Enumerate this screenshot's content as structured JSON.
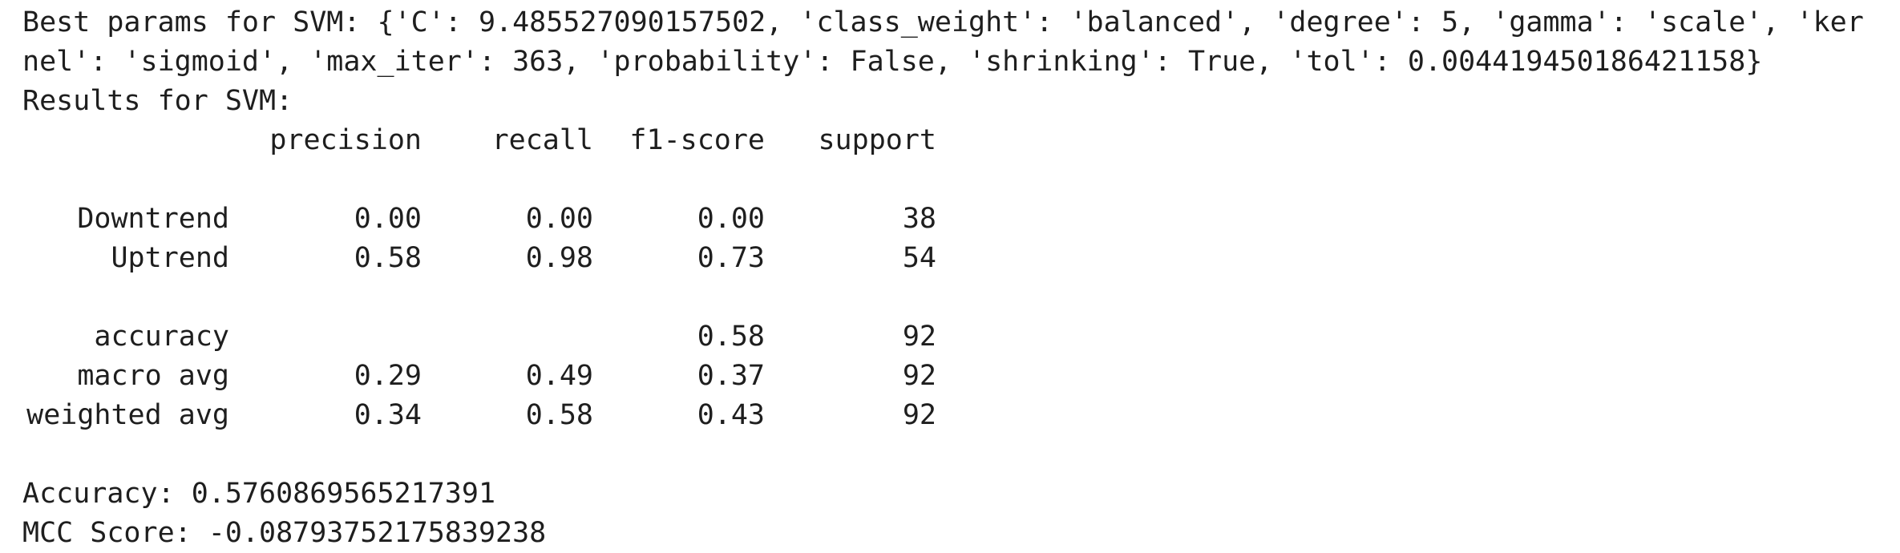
{
  "output": {
    "params_line1": "Best params for SVM: {'C': 9.485527090157502, 'class_weight': 'balanced', 'degree': 5, 'gamma': 'scale', 'ker",
    "params_line2": "nel': 'sigmoid', 'max_iter': 363, 'probability': False, 'shrinking': True, 'tol': 0.004419450186421158}",
    "results_heading": "Results for SVM:",
    "report": {
      "headers": [
        "",
        "precision",
        "recall",
        "f1-score",
        "support"
      ],
      "class_rows": [
        [
          "Downtrend",
          "0.00",
          "0.00",
          "0.00",
          "38"
        ],
        [
          "Uptrend",
          "0.58",
          "0.98",
          "0.73",
          "54"
        ]
      ],
      "summary_rows": [
        [
          "accuracy",
          "",
          "",
          "0.58",
          "92"
        ],
        [
          "macro avg",
          "0.29",
          "0.49",
          "0.37",
          "92"
        ],
        [
          "weighted avg",
          "0.34",
          "0.58",
          "0.43",
          "92"
        ]
      ]
    },
    "accuracy_line": "Accuracy: 0.5760869565217391",
    "mcc_line": "MCC Score: -0.08793752175839238"
  }
}
